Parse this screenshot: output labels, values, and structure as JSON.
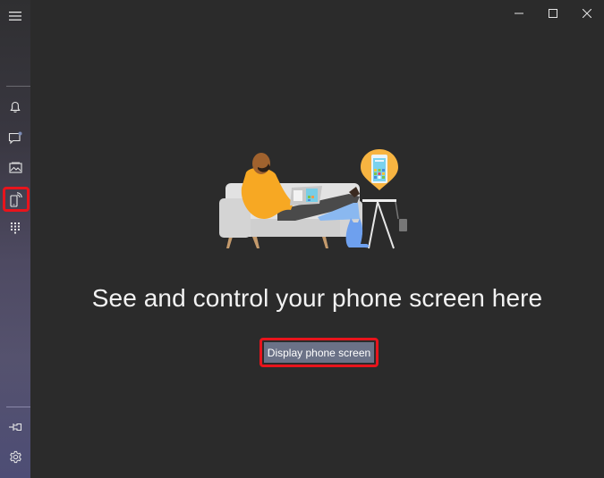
{
  "window": {
    "controls": {
      "minimize_icon": "minimize-icon",
      "maximize_icon": "maximize-icon",
      "close_icon": "close-icon"
    }
  },
  "sidebar": {
    "menu_icon": "hamburger-menu-icon",
    "items": [
      {
        "id": "notifications",
        "icon": "bell-icon"
      },
      {
        "id": "messages",
        "icon": "chat-bubble-icon",
        "badge": true
      },
      {
        "id": "photos",
        "icon": "photo-icon"
      },
      {
        "id": "phone-screen",
        "icon": "phone-screen-icon",
        "selected": true
      },
      {
        "id": "calls",
        "icon": "dialpad-icon"
      }
    ],
    "bottom": [
      {
        "id": "pin",
        "icon": "pin-icon"
      },
      {
        "id": "settings",
        "icon": "gear-icon"
      }
    ]
  },
  "main": {
    "illustration": "person-on-couch-with-laptop-and-phone-illustration",
    "headline": "See and control your phone screen here",
    "cta_label": "Display phone screen"
  },
  "colors": {
    "highlight_border": "#e8141c",
    "cta_background": "#6b7287",
    "background": "#2b2b2b"
  }
}
